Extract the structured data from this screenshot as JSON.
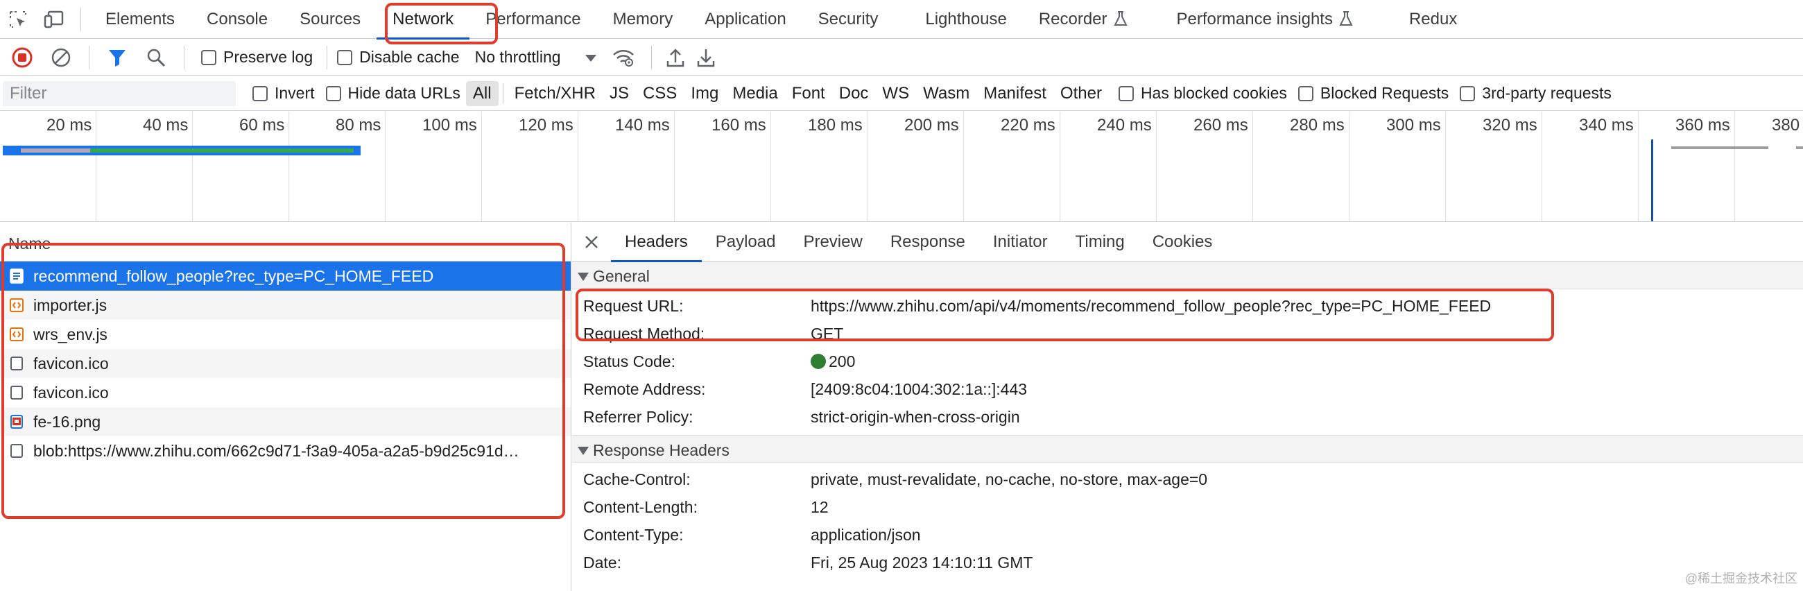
{
  "tabs": {
    "items": [
      {
        "label": "Elements"
      },
      {
        "label": "Console"
      },
      {
        "label": "Sources"
      },
      {
        "label": "Network"
      },
      {
        "label": "Performance"
      },
      {
        "label": "Memory"
      },
      {
        "label": "Application"
      },
      {
        "label": "Security"
      },
      {
        "label": "Lighthouse"
      },
      {
        "label": "Recorder"
      },
      {
        "label": "Performance insights"
      },
      {
        "label": "Redux"
      }
    ],
    "active": "Network"
  },
  "toolbar": {
    "preserve_log": "Preserve log",
    "disable_cache": "Disable cache",
    "throttling": "No throttling"
  },
  "filter": {
    "placeholder": "Filter",
    "invert": "Invert",
    "hide_data_urls": "Hide data URLs",
    "types": [
      "All",
      "Fetch/XHR",
      "JS",
      "CSS",
      "Img",
      "Media",
      "Font",
      "Doc",
      "WS",
      "Wasm",
      "Manifest",
      "Other"
    ],
    "has_blocked_cookies": "Has blocked cookies",
    "blocked_requests": "Blocked Requests",
    "third_party": "3rd-party requests"
  },
  "timeline": {
    "ticks": [
      "20 ms",
      "40 ms",
      "60 ms",
      "80 ms",
      "100 ms",
      "120 ms",
      "140 ms",
      "160 ms",
      "180 ms",
      "200 ms",
      "220 ms",
      "240 ms",
      "260 ms",
      "280 ms",
      "300 ms",
      "320 ms",
      "340 ms",
      "360 ms",
      "380 ms"
    ]
  },
  "requests": {
    "header": "Name",
    "items": [
      {
        "name": "recommend_follow_people?rec_type=PC_HOME_FEED",
        "icon": "document-icon"
      },
      {
        "name": "importer.js",
        "icon": "script-icon"
      },
      {
        "name": "wrs_env.js",
        "icon": "script-icon"
      },
      {
        "name": "favicon.ico",
        "icon": "file-icon"
      },
      {
        "name": "favicon.ico",
        "icon": "file-icon"
      },
      {
        "name": "fe-16.png",
        "icon": "image-icon"
      },
      {
        "name": "blob:https://www.zhihu.com/662c9d71-f3a9-405a-a2a5-b9d25c91d…",
        "icon": "file-icon"
      }
    ]
  },
  "details": {
    "tabs": [
      "Headers",
      "Payload",
      "Preview",
      "Response",
      "Initiator",
      "Timing",
      "Cookies"
    ],
    "active_tab": "Headers",
    "general": {
      "title": "General",
      "rows": [
        {
          "key": "Request URL:",
          "value": "https://www.zhihu.com/api/v4/moments/recommend_follow_people?rec_type=PC_HOME_FEED"
        },
        {
          "key": "Request Method:",
          "value": "GET"
        },
        {
          "key": "Status Code:",
          "value": "200"
        },
        {
          "key": "Remote Address:",
          "value": "[2409:8c04:1004:302:1a::]:443"
        },
        {
          "key": "Referrer Policy:",
          "value": "strict-origin-when-cross-origin"
        }
      ]
    },
    "response_headers": {
      "title": "Response Headers",
      "rows": [
        {
          "key": "Cache-Control:",
          "value": "private, must-revalidate, no-cache, no-store, max-age=0"
        },
        {
          "key": "Content-Length:",
          "value": "12"
        },
        {
          "key": "Content-Type:",
          "value": "application/json"
        },
        {
          "key": "Date:",
          "value": "Fri, 25 Aug 2023 14:10:11 GMT"
        }
      ]
    }
  },
  "colors": {
    "accent": "#1a73e8",
    "annotation": "#e03c2c",
    "status_ok": "#2e7d32"
  },
  "watermark": "@稀土掘金技术社区"
}
